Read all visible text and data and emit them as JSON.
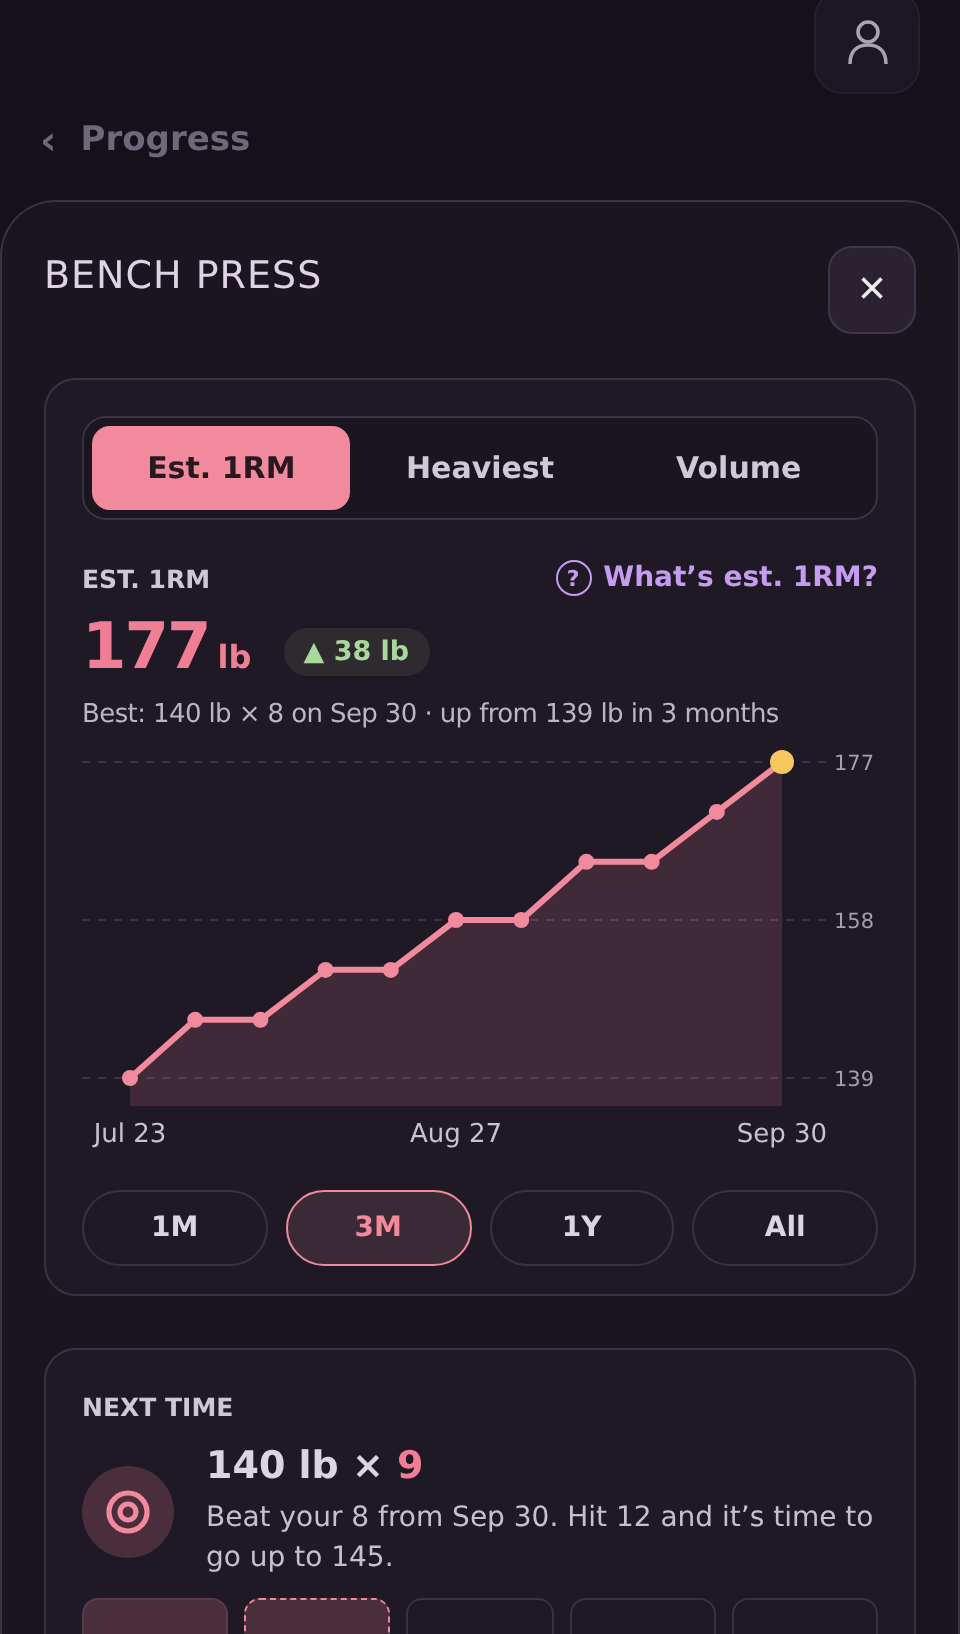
{
  "back_link": {
    "icon": "‹",
    "label": "Progress"
  },
  "sheet": {
    "title": "BENCH PRESS",
    "close": "×"
  },
  "metric_tabs": [
    {
      "label": "Est. 1RM",
      "selected": true
    },
    {
      "label": "Heaviest",
      "selected": false
    },
    {
      "label": "Volume",
      "selected": false
    }
  ],
  "metric": {
    "label": "EST. 1RM",
    "help_icon": "?",
    "help_link": "What’s est. 1RM?",
    "value": "177",
    "unit": "lb",
    "change": "▲ 38 lb",
    "summary": "Best: 140 lb × 8 on Sep 30 · up from 139 lb in 3 months",
    "chart_data": {
      "type": "area",
      "categories": [
        "Jul 23",
        null,
        null,
        null,
        null,
        "Aug 27",
        null,
        null,
        null,
        null,
        "Sep 30"
      ],
      "series": [
        {
          "color": "#f08a9c",
          "marker": "o",
          "values": [
            139,
            146,
            146,
            152,
            152,
            158,
            158,
            165,
            165,
            171,
            177
          ]
        }
      ],
      "ylim": [
        139,
        177
      ],
      "yticks": [
        139,
        158,
        177
      ]
    }
  },
  "ranges": [
    {
      "label": "1M",
      "selected": false
    },
    {
      "label": "3M",
      "selected": true
    },
    {
      "label": "1Y",
      "selected": false
    },
    {
      "label": "All",
      "selected": false
    }
  ],
  "next_time": {
    "label": "NEXT TIME",
    "weight": "140 lb × ",
    "reps": "9",
    "note": "Beat your 8 from Sep 30. Hit 12 and it’s time to go up to 145.",
    "rep_boxes": [
      {
        "kind": "done"
      },
      {
        "kind": "target"
      },
      {
        "kind": "open"
      },
      {
        "kind": "open"
      },
      {
        "kind": "open"
      }
    ]
  }
}
